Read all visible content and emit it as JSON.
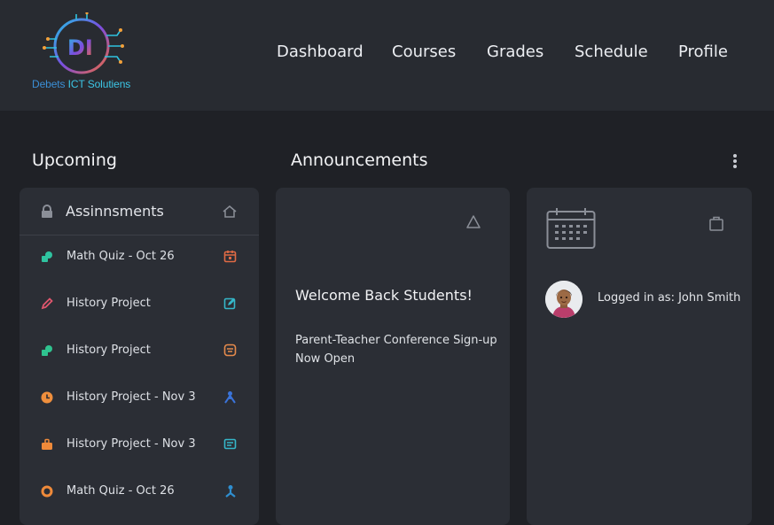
{
  "brand": {
    "name_part1": "Debets ",
    "name_part2": "ICT Solutiens"
  },
  "nav": {
    "items": [
      {
        "label": "Dashboard"
      },
      {
        "label": "Courses"
      },
      {
        "label": "Grades"
      },
      {
        "label": "Schedule"
      },
      {
        "label": "Profile"
      }
    ]
  },
  "sections": {
    "upcoming": "Upcoming",
    "announcements": "Announcements"
  },
  "assignments": {
    "title": "Assinnsments",
    "items": [
      {
        "label": "Math Quiz - Oct 26",
        "icon": "shapes-icon",
        "color": "#2fc3a0",
        "action_icon": "calendar-icon",
        "action_color": "#e06a45"
      },
      {
        "label": "History Project",
        "icon": "pencil-icon",
        "color": "#e0566e",
        "action_icon": "edit-box-icon",
        "action_color": "#35b7c9"
      },
      {
        "label": "History Project",
        "icon": "shapes-icon",
        "color": "#2fc38f",
        "action_icon": "archive-icon",
        "action_color": "#e58a4c"
      },
      {
        "label": "History Project - Nov 3",
        "icon": "clock-icon",
        "color": "#ef8f3d",
        "action_icon": "person-icon",
        "action_color": "#3a73d9"
      },
      {
        "label": "History Project - Nov 3",
        "icon": "briefcase-icon",
        "color": "#ef8a3a",
        "action_icon": "card-icon",
        "action_color": "#35b7c9"
      },
      {
        "label": "Math Quiz - Oct 26",
        "icon": "ring-icon",
        "color": "#ef8a3a",
        "action_icon": "person-icon",
        "action_color": "#2f8fd0"
      }
    ]
  },
  "announcement": {
    "title": "Welcome Back Students!",
    "body": "Parent-Teacher Conference Sign-up Now Open"
  },
  "user": {
    "logged_in_text": "Logged in as: John Smith"
  }
}
